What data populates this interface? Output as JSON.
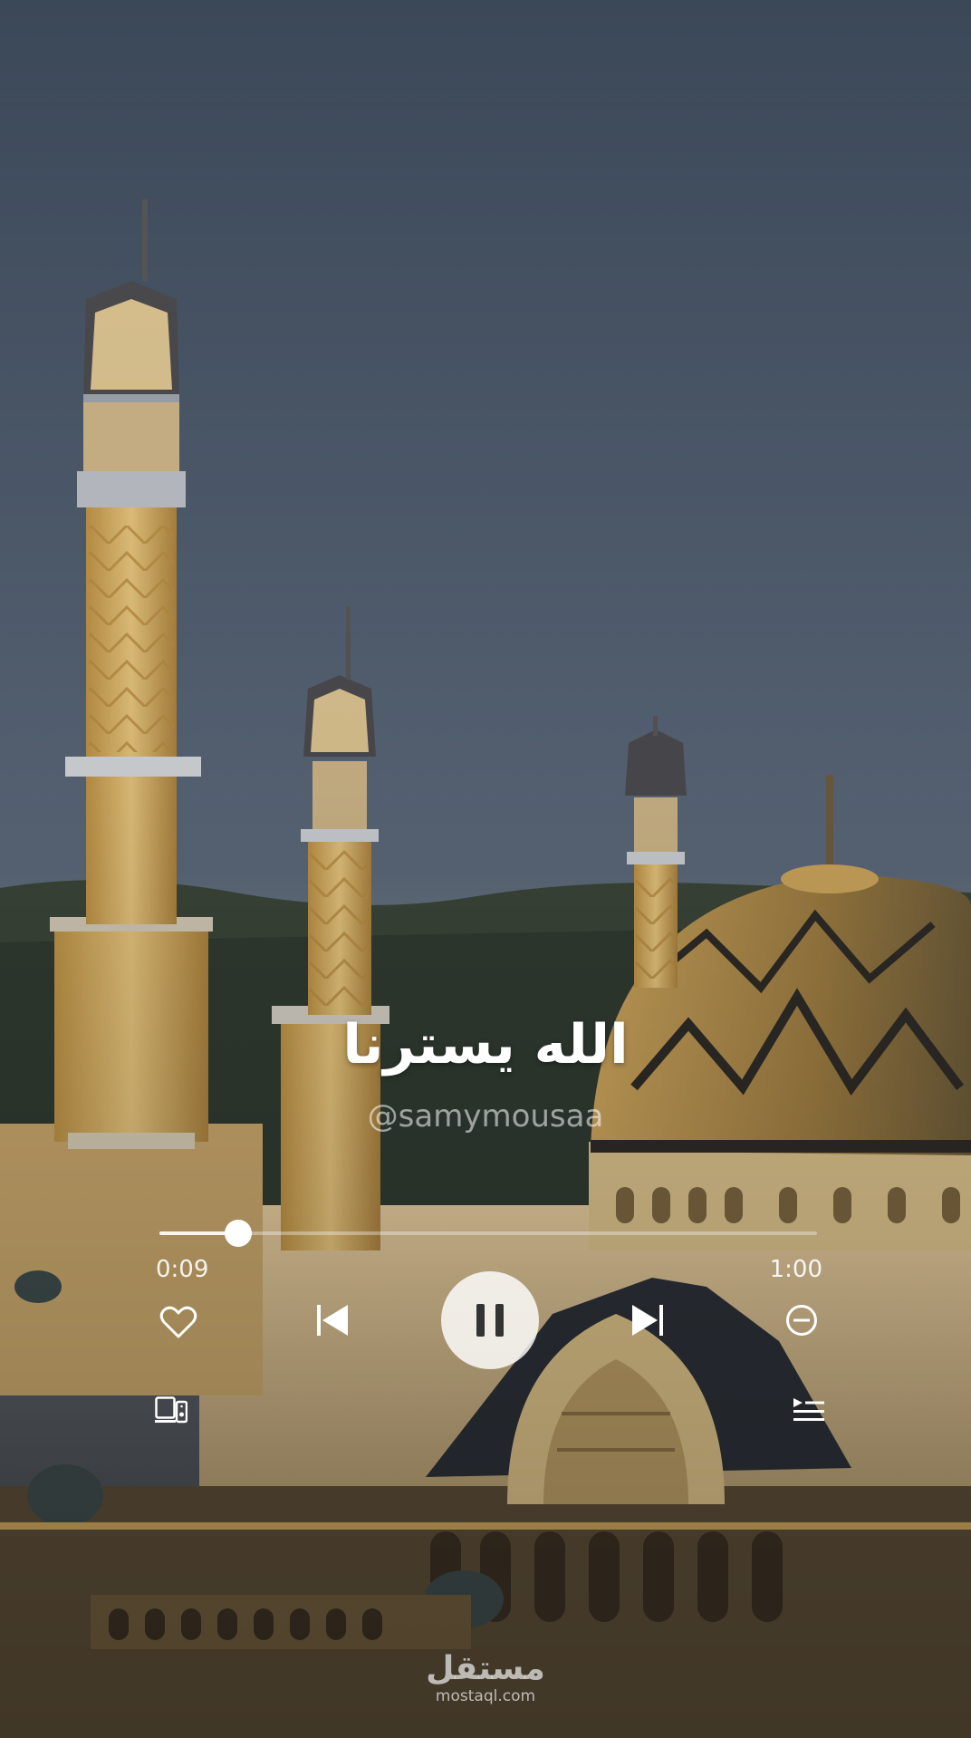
{
  "track": {
    "title": "الله يسترنا",
    "artist": "@samymousaa",
    "elapsed": "0:09",
    "duration": "1:00",
    "progress": 0.12
  },
  "controls": {
    "like": "heart-icon",
    "previous": "skip-previous-icon",
    "play_pause": "pause-icon",
    "next": "skip-next-icon",
    "remove": "minus-circle-icon",
    "devices": "devices-icon",
    "queue": "queue-list-icon"
  },
  "watermark": {
    "logo": "مستقل",
    "url": "mostaql.com"
  },
  "colors": {
    "sky_top": "#3b4858",
    "sky_mid": "#5a6778",
    "haze": "#6f7782",
    "gold": "#d6ad58",
    "dark_roof": "#2b2f36",
    "control_white": "#ffffff"
  }
}
